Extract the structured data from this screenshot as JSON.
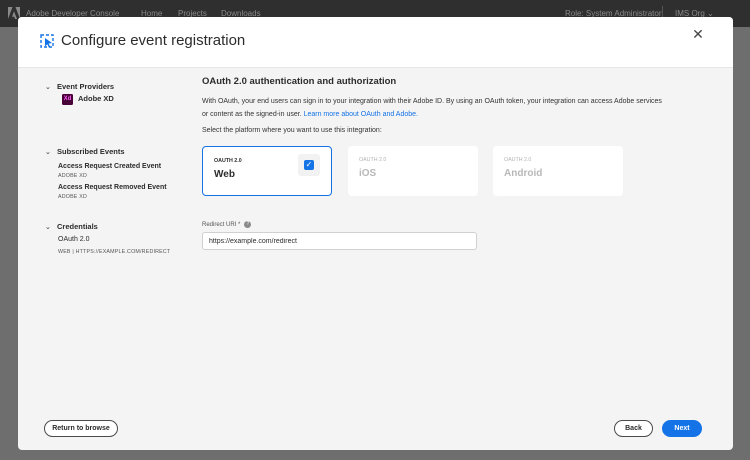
{
  "topbar": {
    "app_title": "Adobe Developer Console",
    "nav": [
      "Home",
      "Projects",
      "Downloads"
    ],
    "role": "Role: System Administrator",
    "org": "IMS Org"
  },
  "modal": {
    "title": "Configure event registration",
    "sidebar": {
      "event_providers": {
        "heading": "Event Providers",
        "items": [
          {
            "icon_text": "Xd",
            "label": "Adobe XD"
          }
        ]
      },
      "subscribed_events": {
        "heading": "Subscribed Events",
        "items": [
          {
            "name": "Access Request Created Event",
            "provider": "ADOBE XD"
          },
          {
            "name": "Access Request Removed Event",
            "provider": "ADOBE XD"
          }
        ]
      },
      "credentials": {
        "heading": "Credentials",
        "items": [
          {
            "name": "OAuth 2.0",
            "detail": "WEB | HTTPS://EXAMPLE.COM/REDIRECT"
          }
        ]
      }
    },
    "main": {
      "heading": "OAuth 2.0 authentication and authorization",
      "description": "With OAuth, your end users can sign in to your integration with their Adobe ID. By using an OAuth token, your integration can access Adobe services or content as the signed-in user.",
      "learn_more": "Learn more about OAuth and Adobe.",
      "select_label": "Select the platform where you want to use this integration:",
      "platforms": [
        {
          "type": "OAUTH 2.0",
          "name": "Web",
          "selected": true
        },
        {
          "type": "OAUTH 2.0",
          "name": "iOS",
          "selected": false
        },
        {
          "type": "OAUTH 2.0",
          "name": "Android",
          "selected": false
        }
      ],
      "redirect_label": "Redirect URI",
      "required_mark": "*",
      "redirect_value": "https://example.com/redirect"
    },
    "footer": {
      "return_label": "Return to browse",
      "back_label": "Back",
      "next_label": "Next"
    }
  },
  "colors": {
    "accent": "#1473e6",
    "xd_bg": "#470137",
    "xd_fg": "#ff61f6"
  }
}
